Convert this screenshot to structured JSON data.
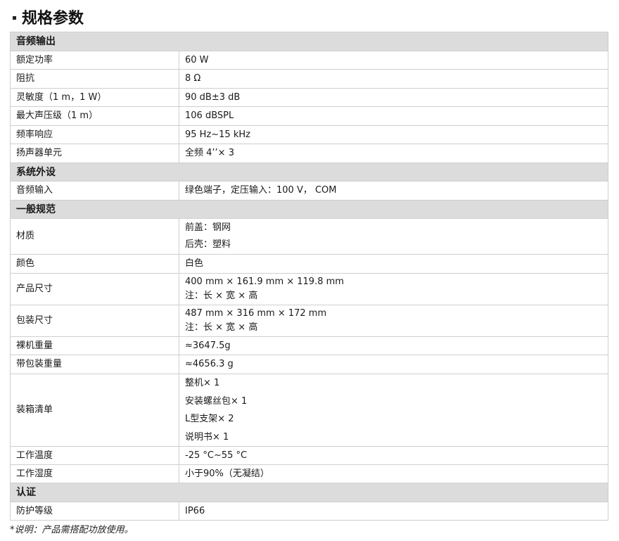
{
  "title": "规格参数",
  "sections": {
    "audio": {
      "header": "音频输出"
    },
    "system": {
      "header": "系统外设"
    },
    "general": {
      "header": "一般规范"
    },
    "cert": {
      "header": "认证"
    }
  },
  "rows": {
    "rated_power": {
      "label": "额定功率",
      "value": "60 W"
    },
    "impedance": {
      "label": "阻抗",
      "value": "8 Ω"
    },
    "sensitivity": {
      "label": "灵敏度（1 m，1 W）",
      "value": "90 dB±3 dB"
    },
    "max_spl": {
      "label": "最大声压级（1 m）",
      "value": "106 dBSPL"
    },
    "freq_response": {
      "label": "频率响应",
      "value": "95 Hz~15 kHz"
    },
    "speaker_unit": {
      "label": "扬声器单元",
      "value": "全频  4’’× 3"
    },
    "audio_input": {
      "label": "音频输入",
      "value": "绿色端子，定压输入：100 V，  COM"
    },
    "material": {
      "label": "材质",
      "lines": [
        "前盖：钢网",
        "后壳：塑料"
      ]
    },
    "color": {
      "label": "颜色",
      "value": "白色"
    },
    "product_size": {
      "label": "产品尺寸",
      "lines": [
        "400 mm × 161.9 mm × 119.8 mm",
        "注：长 × 宽 × 高"
      ]
    },
    "package_size": {
      "label": "包装尺寸",
      "lines": [
        "487 mm × 316 mm × 172 mm",
        "注：长 × 宽 × 高"
      ]
    },
    "net_weight": {
      "label": "裸机重量",
      "value": "≈3647.5g"
    },
    "gross_weight": {
      "label": "带包装重量",
      "value": "≈4656.3 g"
    },
    "packing_list": {
      "label": "装箱清单",
      "lines": [
        "整机× 1",
        "安装螺丝包× 1",
        "L型支架× 2",
        "说明书× 1"
      ]
    },
    "op_temp": {
      "label": "工作温度",
      "value": "-25 °C~55 °C"
    },
    "op_humidity": {
      "label": "工作湿度",
      "value": "小于90%（无凝结）"
    },
    "protection": {
      "label": "防护等级",
      "value": "IP66"
    }
  },
  "footnote": "*说明：产品需搭配功放使用。"
}
